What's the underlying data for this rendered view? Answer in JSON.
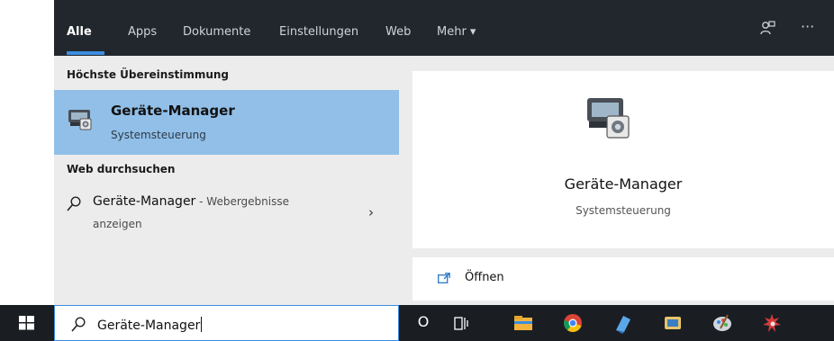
{
  "tabs": [
    {
      "label": "Alle"
    },
    {
      "label": "Apps"
    },
    {
      "label": "Dokumente"
    },
    {
      "label": "Einstellungen"
    },
    {
      "label": "Web"
    },
    {
      "label": "Mehr ▾"
    }
  ],
  "top_icons": [
    "feedback-icon",
    "more-options-icon"
  ],
  "top_more_glyph": "···",
  "sections": {
    "best_match": "Höchste Übereinstimmung",
    "web": "Web durchsuchen"
  },
  "best_match": {
    "title": "Geräte-Manager",
    "subtitle": "Systemsteuerung",
    "icon": "device-manager-icon"
  },
  "web_result": {
    "title": "Geräte-Manager",
    "suffix": " - Webergebnisse",
    "subtitle": "anzeigen",
    "chevron": "›"
  },
  "detail": {
    "title": "Geräte-Manager",
    "subtitle": "Systemsteuerung",
    "action_open": "Öffnen"
  },
  "taskbar": {
    "search_text": "Geräte-Manager",
    "cortana_glyph": "O",
    "apps": [
      "task-view-icon",
      "file-explorer-icon",
      "chrome-icon",
      "app-icon-blue",
      "app-icon-notepad",
      "paint-icon",
      "app-icon-red"
    ]
  },
  "colors": {
    "topbar": "#22272d",
    "accent": "#3b8de0",
    "selection": "#91bfe8",
    "taskbar": "#1a1e23"
  }
}
